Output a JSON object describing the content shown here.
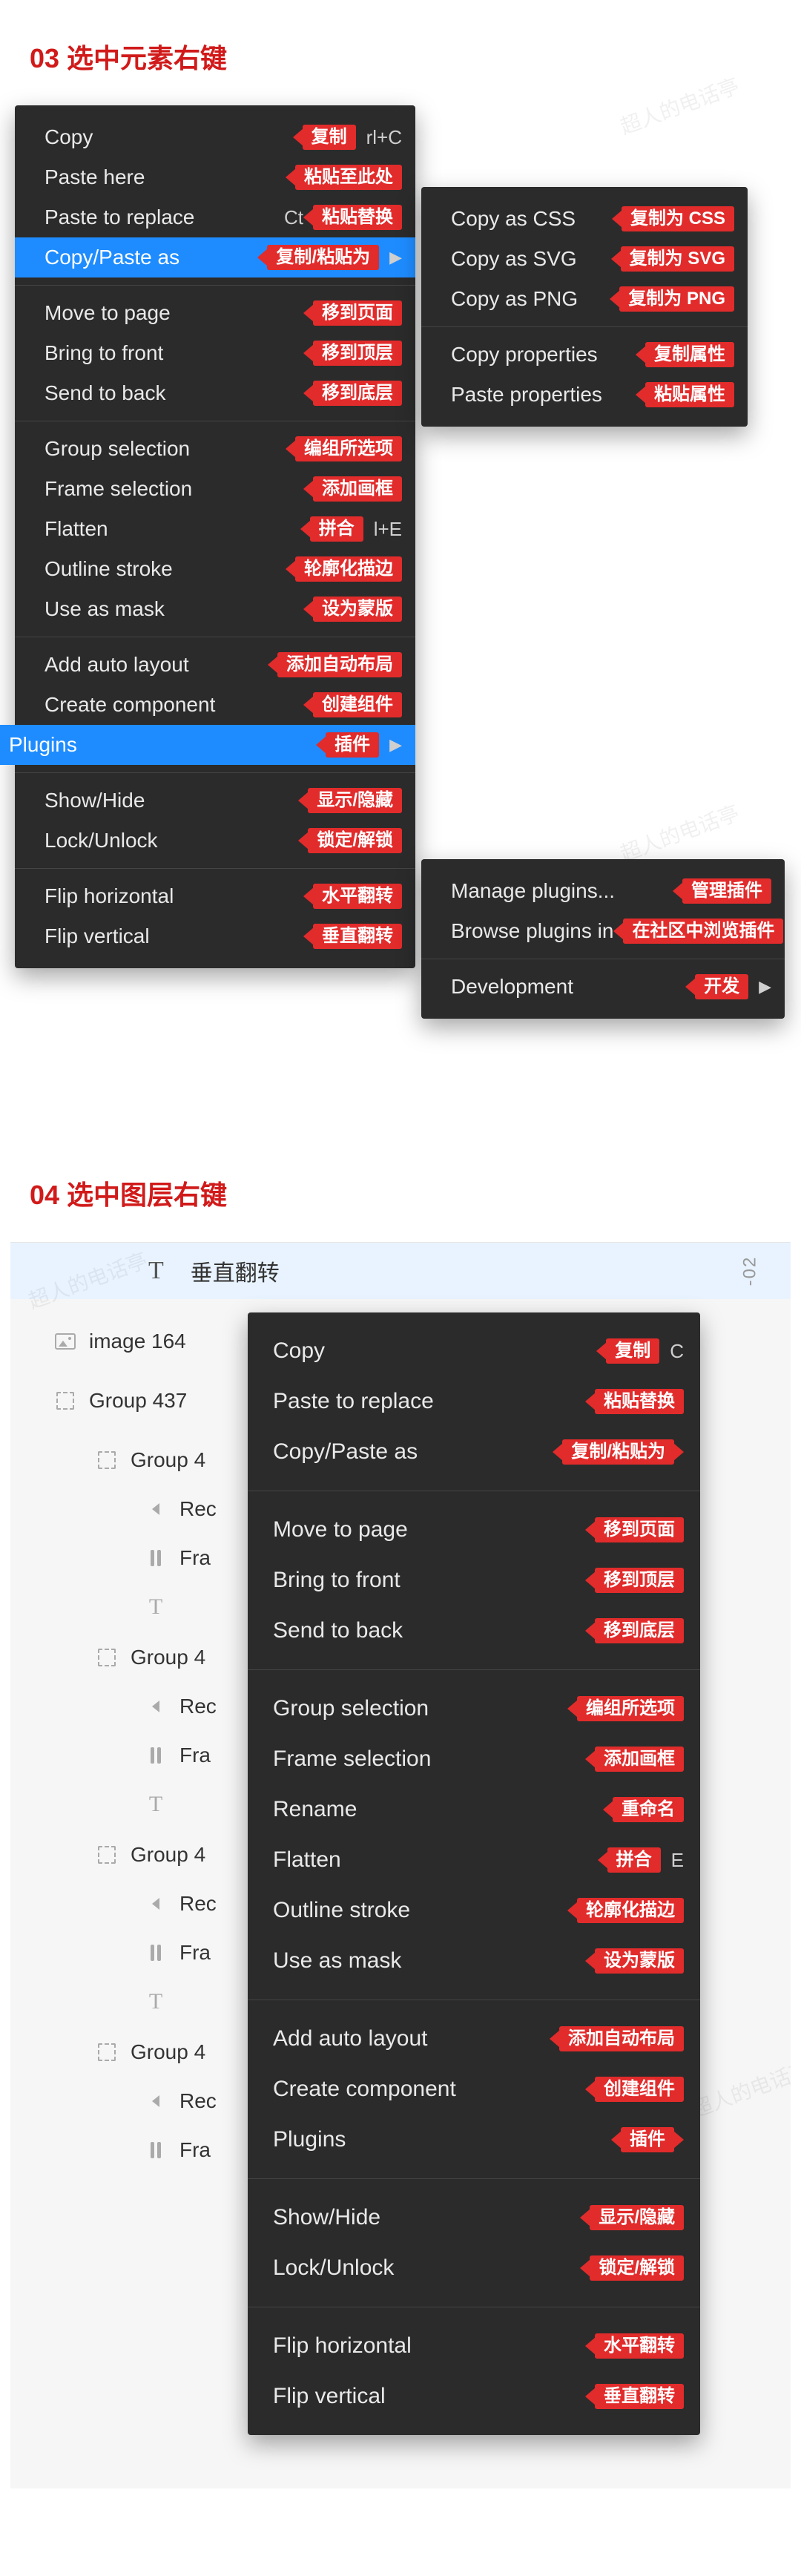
{
  "watermark": "超人的电话亭",
  "section03": {
    "title": "03 选中元素右键"
  },
  "section04": {
    "title": "04 选中图层右键"
  },
  "menu1": {
    "g1": [
      {
        "label": "Copy",
        "shortcut": "rl+C",
        "tag": "复制"
      },
      {
        "label": "Paste here",
        "tag": "粘贴至此处"
      },
      {
        "label": "Paste to replace",
        "shortcut": "Ct",
        "tag": "粘贴替换",
        "shortcut_pos": "before"
      },
      {
        "label": "Copy/Paste as",
        "tag": "复制/粘贴为",
        "selected": true,
        "chevron": true
      }
    ],
    "g2": [
      {
        "label": "Move to page",
        "tag": "移到页面"
      },
      {
        "label": "Bring to front",
        "tag": "移到顶层"
      },
      {
        "label": "Send to back",
        "tag": "移到底层"
      }
    ],
    "g3": [
      {
        "label": "Group selection",
        "tag": "编组所选项"
      },
      {
        "label": "Frame selection",
        "tag": "添加画框"
      },
      {
        "label": "Flatten",
        "shortcut": "l+E",
        "tag": "拼合"
      },
      {
        "label": "Outline stroke",
        "tag": "轮廓化描边"
      },
      {
        "label": "Use as mask",
        "tag": "设为蒙版"
      }
    ],
    "g4": [
      {
        "label": "Add auto layout",
        "tag": "添加自动布局"
      },
      {
        "label": "Create component",
        "tag": "创建组件"
      },
      {
        "label": "Plugins",
        "tag": "插件",
        "selected": true,
        "chevron": true,
        "bleed": true
      }
    ],
    "g5": [
      {
        "label": "Show/Hide",
        "tag": "显示/隐藏"
      },
      {
        "label": "Lock/Unlock",
        "tag": "锁定/解锁"
      }
    ],
    "g6": [
      {
        "label": "Flip horizontal",
        "tag": "水平翻转"
      },
      {
        "label": "Flip vertical",
        "tag": "垂直翻转"
      }
    ]
  },
  "menu2": {
    "g1": [
      {
        "label": "Copy as CSS",
        "tag": "复制为 CSS"
      },
      {
        "label": "Copy as SVG",
        "tag": "复制为 SVG"
      },
      {
        "label": "Copy as PNG",
        "tag": "复制为 PNG"
      }
    ],
    "g2": [
      {
        "label": "Copy properties",
        "tag": "复制属性"
      },
      {
        "label": "Paste properties",
        "tag": "粘贴属性"
      }
    ]
  },
  "menu3": {
    "g1": [
      {
        "label": "Manage plugins...",
        "tag": "管理插件"
      },
      {
        "label": "Browse plugins in",
        "tag": "在社区中浏览插件"
      }
    ],
    "g2": [
      {
        "label": "Development",
        "tag": "开发",
        "chevron": true
      }
    ]
  },
  "panel": {
    "top_label": "垂直翻转",
    "top_right": "-02",
    "layers": [
      {
        "icon": "image",
        "text": "image 164",
        "indent": 1
      },
      {
        "icon": "dashed",
        "text": "Group 437",
        "indent": 1
      },
      {
        "icon": "dashed",
        "text": "Group 4",
        "indent": 2
      },
      {
        "icon": "tri",
        "text": "Rec",
        "indent": 3
      },
      {
        "icon": "bars",
        "text": "Fra",
        "indent": 3
      },
      {
        "icon": "T",
        "text": "",
        "indent": 3
      },
      {
        "icon": "dashed",
        "text": "Group 4",
        "indent": 2
      },
      {
        "icon": "tri",
        "text": "Rec",
        "indent": 3
      },
      {
        "icon": "bars",
        "text": "Fra",
        "indent": 3
      },
      {
        "icon": "T",
        "text": "",
        "indent": 3
      },
      {
        "icon": "dashed",
        "text": "Group 4",
        "indent": 2
      },
      {
        "icon": "tri",
        "text": "Rec",
        "indent": 3
      },
      {
        "icon": "bars",
        "text": "Fra",
        "indent": 3
      },
      {
        "icon": "T",
        "text": "",
        "indent": 3
      },
      {
        "icon": "dashed",
        "text": "Group 4",
        "indent": 2
      },
      {
        "icon": "tri",
        "text": "Rec",
        "indent": 3
      },
      {
        "icon": "bars",
        "text": "Fra",
        "indent": 3
      }
    ]
  },
  "menu4": {
    "g1": [
      {
        "label": "Copy",
        "shortcut": "C",
        "tag": "复制"
      },
      {
        "label": "Paste to replace",
        "tag": "粘贴替换"
      },
      {
        "label": "Copy/Paste as",
        "tag": "复制/粘贴为",
        "chevron_after_tag": true
      }
    ],
    "g2": [
      {
        "label": "Move to page",
        "tag": "移到页面"
      },
      {
        "label": "Bring to front",
        "tag": "移到顶层"
      },
      {
        "label": "Send to back",
        "tag": "移到底层"
      }
    ],
    "g3": [
      {
        "label": "Group selection",
        "tag": "编组所选项"
      },
      {
        "label": "Frame selection",
        "tag": "添加画框"
      },
      {
        "label": "Rename",
        "tag": "重命名"
      },
      {
        "label": "Flatten",
        "shortcut": "E",
        "tag": "拼合"
      },
      {
        "label": "Outline stroke",
        "tag": "轮廓化描边"
      },
      {
        "label": "Use as mask",
        "tag": "设为蒙版"
      }
    ],
    "g4": [
      {
        "label": "Add auto layout",
        "tag": "添加自动布局"
      },
      {
        "label": "Create component",
        "tag": "创建组件"
      },
      {
        "label": "Plugins",
        "tag": "插件",
        "chevron_after_tag": true
      }
    ],
    "g5": [
      {
        "label": "Show/Hide",
        "tag": "显示/隐藏"
      },
      {
        "label": "Lock/Unlock",
        "tag": "锁定/解锁"
      }
    ],
    "g6": [
      {
        "label": "Flip horizontal",
        "tag": "水平翻转"
      },
      {
        "label": "Flip vertical",
        "tag": "垂直翻转"
      }
    ]
  }
}
